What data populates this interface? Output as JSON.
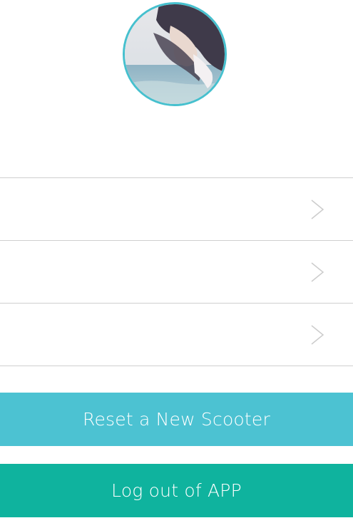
{
  "profile": {
    "avatar_icon": "user-avatar-photo",
    "border_color": "#46c0ce"
  },
  "menu": {
    "items": [
      {
        "label": "",
        "icon": "chevron-right-icon"
      },
      {
        "label": "",
        "icon": "chevron-right-icon"
      },
      {
        "label": "",
        "icon": "chevron-right-icon"
      }
    ]
  },
  "actions": {
    "reset_label": "Reset a New Scooter",
    "reset_color": "#4cc2d2",
    "logout_label": "Log out of APP",
    "logout_color": "#0fb39e"
  }
}
